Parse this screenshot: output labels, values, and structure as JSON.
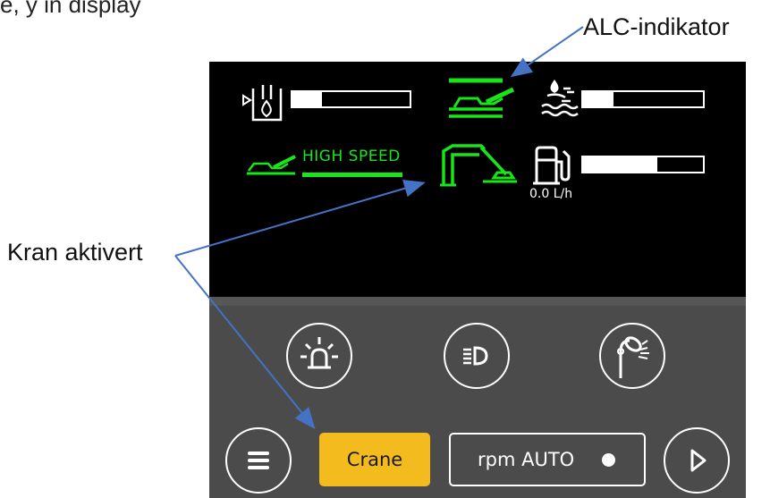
{
  "caption": {
    "top_text": "e, y in display"
  },
  "callouts": {
    "alc": "ALC-indikator",
    "kran": "Kran aktivert"
  },
  "screen": {
    "high_speed_label": "HIGH SPEED",
    "fuel_rate": "0.0 L/h",
    "gauges": {
      "hydraulic_oil_level": 0.25,
      "coolant_level": 0.25,
      "fuel_level": 0.62
    },
    "indicator_color": "#19e619"
  },
  "panel": {
    "crane_label": "Crane",
    "rpm_label": "rpm AUTO",
    "crane_color": "#f4bb1f"
  },
  "arrow_color": "#4472c4"
}
